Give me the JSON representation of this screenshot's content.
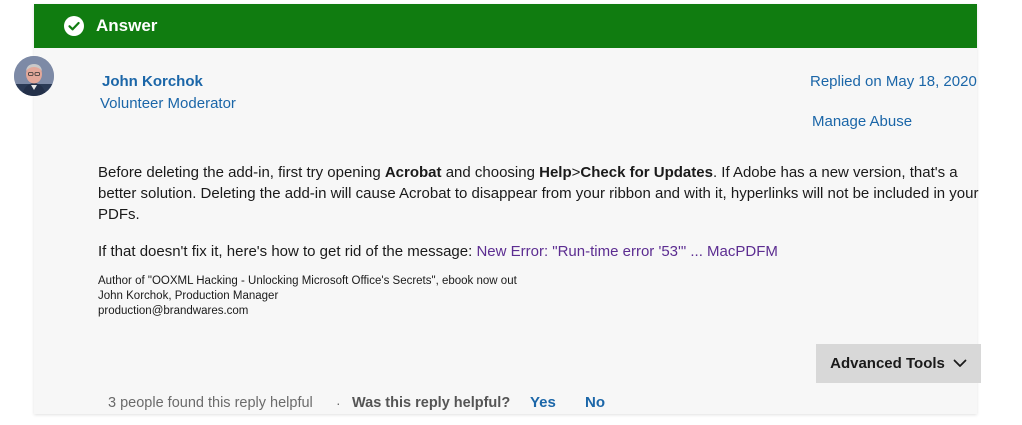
{
  "answer_bar": {
    "label": "Answer",
    "color": "#107c10",
    "icon": "check-circle-icon"
  },
  "author": {
    "name": "John Korchok",
    "role": "Volunteer Moderator",
    "avatar_icon": "avatar"
  },
  "replied_on": "Replied on May 18, 2020",
  "manage_abuse": "Manage Abuse",
  "body": {
    "p1_a": "Before deleting the add-in, first try opening ",
    "p1_bold1": "Acrobat",
    "p1_b": " and choosing ",
    "p1_bold2": "Help",
    "p1_c": ">",
    "p1_bold3": "Check for Updates",
    "p1_d": ". If Adobe has a new version, that's a better solution. Deleting the add-in will cause Acrobat to disappear from your ribbon and with it, hyperlinks will not be included in your PDFs.",
    "p2_text": "If that doesn't fix it, here's how to get rid of the message: ",
    "p2_link": "New Error: \"Run-time error '53'\" ... MacPDFM"
  },
  "signature": {
    "line1": "Author of \"OOXML Hacking - Unlocking Microsoft Office's Secrets\", ebook now out",
    "line2": "John Korchok, Production Manager",
    "line3": "production@brandwares.com"
  },
  "advanced_tools": {
    "label": "Advanced Tools",
    "icon": "chevron-down-icon"
  },
  "feedback": {
    "count_text": "3 people found this reply helpful",
    "separator": "·",
    "question": "Was this reply helpful?",
    "yes": "Yes",
    "no": "No"
  },
  "colors": {
    "link": "#1b66a8",
    "visited_link": "#5c2d91",
    "card_bg": "#f7f7f7"
  }
}
